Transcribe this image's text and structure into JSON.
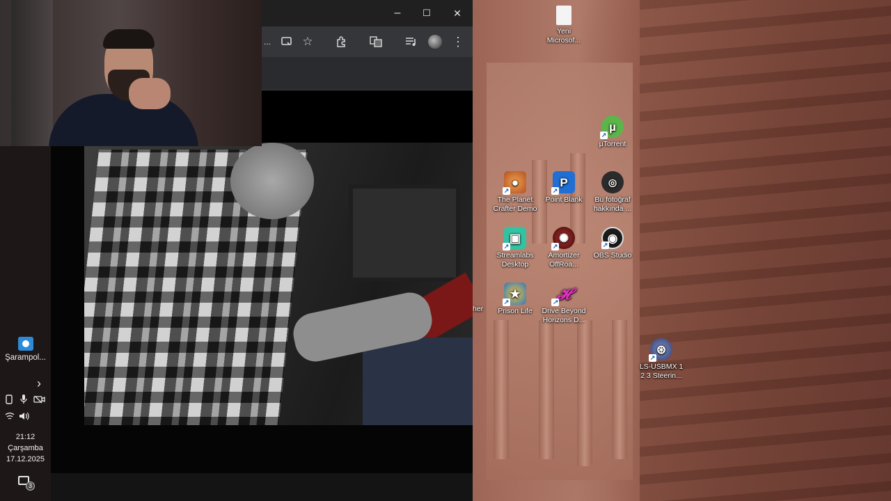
{
  "browser": {
    "window_controls": {
      "minimize": "–",
      "maximize": "☐",
      "close": "✕"
    },
    "toolbar_icons": [
      "more-menu-icon",
      "cast-icon",
      "bookmark-star-icon",
      "extensions-icon",
      "translate-icon",
      "media-queue-icon",
      "profile-icon",
      "kebab-menu-icon"
    ],
    "toolbar_overflow": "...",
    "star": "☆",
    "kebab": "⋮"
  },
  "desktop": {
    "icons": [
      {
        "label": "Yeni Microsof...",
        "icon": "document-icon",
        "color": "#f0f0f0"
      },
      {
        "label": "μTorrent",
        "icon": "utorrent-icon",
        "color": "#5cb54a"
      },
      {
        "label": "The Planet Crafter Demo",
        "icon": "planet-crafter-icon",
        "color": "#d07030"
      },
      {
        "label": "Point Blank",
        "icon": "point-blank-icon",
        "color": "#1f6fd4"
      },
      {
        "label": "Bu fotoğraf hakkında ...",
        "icon": "camera-info-icon",
        "color": "#222222"
      },
      {
        "label": "Streamlabs Desktop",
        "icon": "streamlabs-icon",
        "color": "#31c3a2"
      },
      {
        "label": "Amortizer OffRoa...",
        "icon": "amortizer-icon",
        "color": "#8a1010"
      },
      {
        "label": "OBS Studio",
        "icon": "obs-icon",
        "color": "#1b1b1b"
      },
      {
        "label": "Prison Life",
        "icon": "prison-life-icon",
        "color": "#2a7ac0"
      },
      {
        "label": "Drive Beyond Horizons D...",
        "icon": "drive-beyond-icon",
        "color": "#c020a0"
      },
      {
        "label": "LS-USBMX 1 2 3 Steerin...",
        "icon": "steering-wheel-icon",
        "color": "#3a4a8a"
      }
    ],
    "partial_label": "her"
  },
  "taskbar": {
    "pinned_app_label": "Şarampol...",
    "chevron": "›",
    "clock": {
      "time": "21:12",
      "day": "Çarşamba",
      "date": "17.12.2025"
    },
    "notification_count": "3"
  }
}
